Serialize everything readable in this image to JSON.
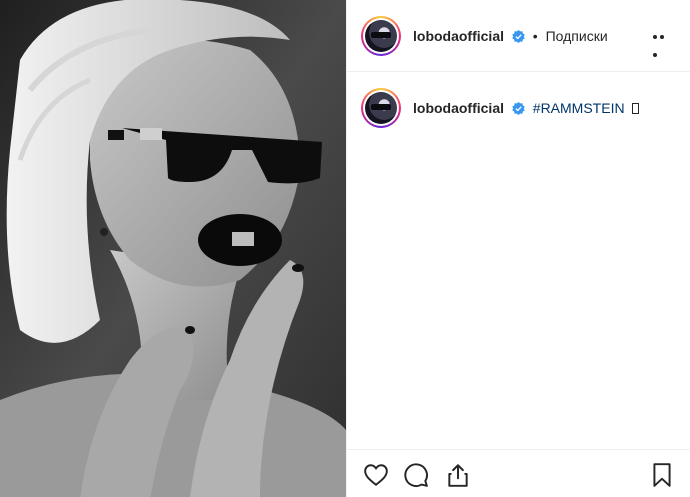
{
  "post": {
    "author": {
      "username": "lobodaofficial",
      "verified": true
    },
    "header": {
      "separator": "•",
      "follow_label": "Подписки"
    },
    "caption": {
      "username": "lobodaofficial",
      "hashtag": "#RAMMSTEIN"
    },
    "icons": {
      "more": "more-options-icon",
      "like": "heart-icon",
      "comment": "comment-icon",
      "share": "share-icon",
      "save": "bookmark-icon",
      "verified": "verified-badge-icon"
    },
    "colors": {
      "verified": "#3897f0",
      "hashtag": "#003569",
      "text": "#262626",
      "border": "#efefef"
    }
  }
}
